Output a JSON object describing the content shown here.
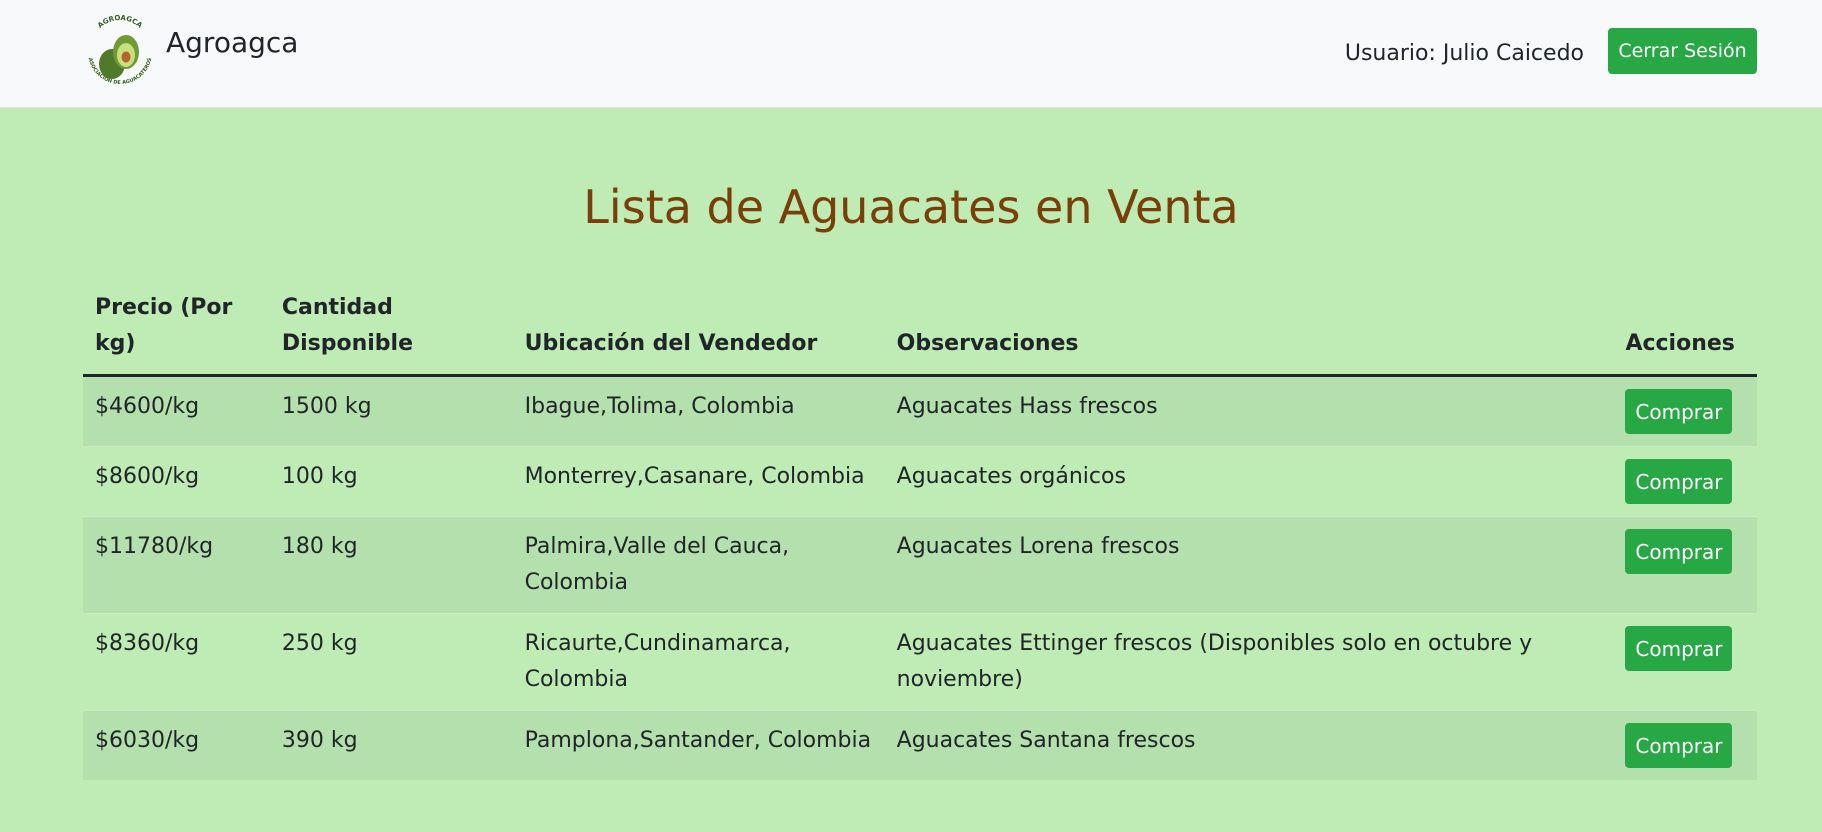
{
  "navbar": {
    "brand_name": "Agroagca",
    "logo": {
      "icon": "avocado-logo-icon",
      "text_top": "AGROAGCA",
      "text_bottom": "ASOCIACION DE AGUACATEROS",
      "colors": {
        "dark_green": "#4f7a2a",
        "light_green": "#8dbb4c",
        "seed": "#b5652a"
      }
    },
    "user_label": "Usuario: Julio Caicedo",
    "logout_label": "Cerrar Sesión"
  },
  "main": {
    "title": "Lista de Aguacates en Venta",
    "table": {
      "headers": {
        "price": "Precio (Por kg)",
        "quantity": "Cantidad Disponible",
        "location": "Ubicación del Vendedor",
        "notes": "Observaciones",
        "actions": "Acciones"
      },
      "rows": [
        {
          "price": "$4600/kg",
          "quantity": "1500 kg",
          "location": "Ibague,Tolima, Colombia",
          "notes": "Aguacates Hass frescos",
          "action": "Comprar"
        },
        {
          "price": "$8600/kg",
          "quantity": "100 kg",
          "location": "Monterrey,Casanare, Colombia",
          "notes": "Aguacates orgánicos",
          "action": "Comprar"
        },
        {
          "price": "$11780/kg",
          "quantity": "180 kg",
          "location": "Palmira,Valle del Cauca, Colombia",
          "notes": "Aguacates Lorena frescos",
          "action": "Comprar"
        },
        {
          "price": "$8360/kg",
          "quantity": "250 kg",
          "location": "Ricaurte,Cundinamarca, Colombia",
          "notes": "Aguacates Ettinger frescos (Disponibles solo en octubre y noviembre)",
          "action": "Comprar"
        },
        {
          "price": "$6030/kg",
          "quantity": "390 kg",
          "location": "Pamplona,Santander, Colombia",
          "notes": "Aguacates Santana frescos",
          "action": "Comprar"
        }
      ]
    }
  },
  "colors": {
    "page_background": "#beecb4",
    "title": "#7a3e08",
    "button": "#28a745",
    "navbar": "#f8f9fa"
  }
}
